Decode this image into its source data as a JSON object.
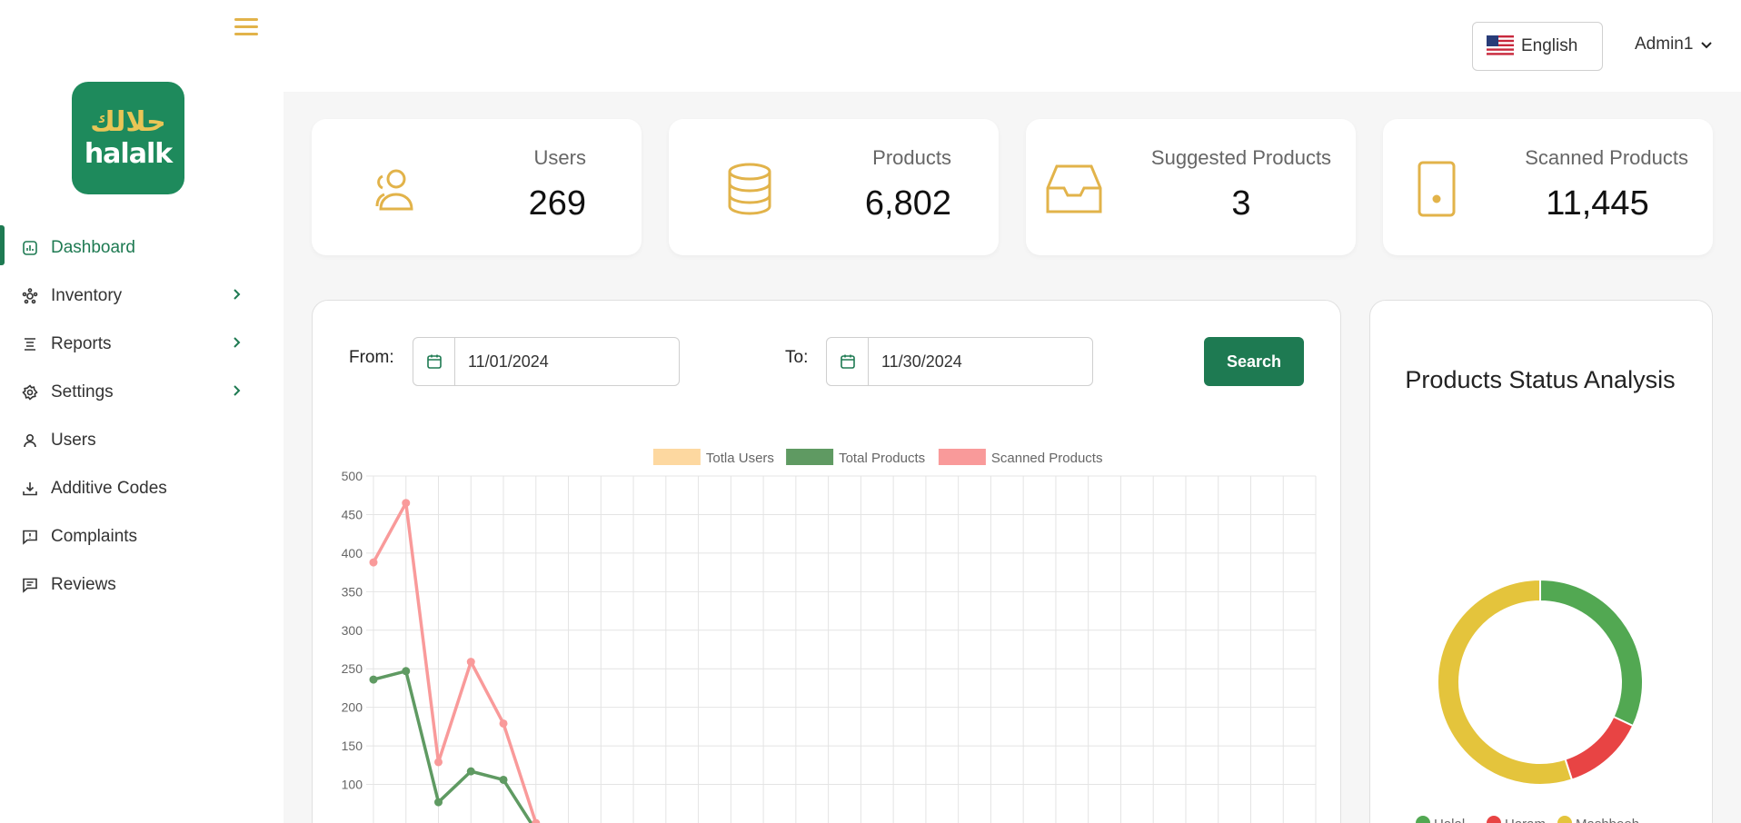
{
  "brand": {
    "name_ar": "حلالك",
    "name_en": "halalk"
  },
  "sidebar": {
    "items": [
      {
        "label": "Dashboard",
        "icon": "dashboard-icon",
        "active": true,
        "has_children": false
      },
      {
        "label": "Inventory",
        "icon": "inventory-icon",
        "active": false,
        "has_children": true
      },
      {
        "label": "Reports",
        "icon": "reports-icon",
        "active": false,
        "has_children": true
      },
      {
        "label": "Settings",
        "icon": "gear-icon",
        "active": false,
        "has_children": true
      },
      {
        "label": "Users",
        "icon": "user-icon",
        "active": false,
        "has_children": false
      },
      {
        "label": "Additive Codes",
        "icon": "download-icon",
        "active": false,
        "has_children": false
      },
      {
        "label": "Complaints",
        "icon": "complaint-icon",
        "active": false,
        "has_children": false
      },
      {
        "label": "Reviews",
        "icon": "review-icon",
        "active": false,
        "has_children": false
      }
    ]
  },
  "header": {
    "language": "English",
    "user": "Admin1"
  },
  "stats": [
    {
      "label": "Users",
      "value": "269",
      "icon": "users-icon"
    },
    {
      "label": "Products",
      "value": "6,802",
      "icon": "database-icon"
    },
    {
      "label": "Suggested Products",
      "value": "3",
      "icon": "inbox-icon"
    },
    {
      "label": "Scanned Products",
      "value": "11,445",
      "icon": "phone-icon"
    }
  ],
  "filters": {
    "from_label": "From:",
    "to_label": "To:",
    "from_value": "11/01/2024",
    "to_value": "11/30/2024",
    "search_label": "Search"
  },
  "colors": {
    "accent": "#1e7a52",
    "gold": "#e2b34a",
    "users_series": "#fdd8a0",
    "products_series": "#5f9a62",
    "scanned_series": "#f99a9a",
    "halal": "#52a852",
    "haram": "#e84444",
    "mashbooh": "#e4c43c"
  },
  "chart_data": [
    {
      "type": "line",
      "legend_position": "top",
      "grid": true,
      "ylim": [
        50,
        500
      ],
      "yticks": [
        100,
        150,
        200,
        250,
        300,
        350,
        400,
        450,
        500
      ],
      "x_count": 30,
      "series": [
        {
          "name": "Totla Users",
          "color": "#fdd8a0",
          "values": []
        },
        {
          "name": "Total Products",
          "color": "#5f9a62",
          "values": [
            236,
            247,
            77,
            117,
            106,
            40
          ]
        },
        {
          "name": "Scanned Products",
          "color": "#f99a9a",
          "values": [
            388,
            465,
            129,
            259,
            179,
            50
          ]
        }
      ]
    },
    {
      "type": "pie",
      "title": "Products Status Analysis",
      "donut": true,
      "legend_position": "bottom",
      "slices": [
        {
          "name": "Halal",
          "value": 32,
          "color": "#52a852"
        },
        {
          "name": "Haram",
          "value": 13,
          "color": "#e84444"
        },
        {
          "name": "Mashbooh",
          "value": 55,
          "color": "#e4c43c"
        }
      ]
    }
  ]
}
